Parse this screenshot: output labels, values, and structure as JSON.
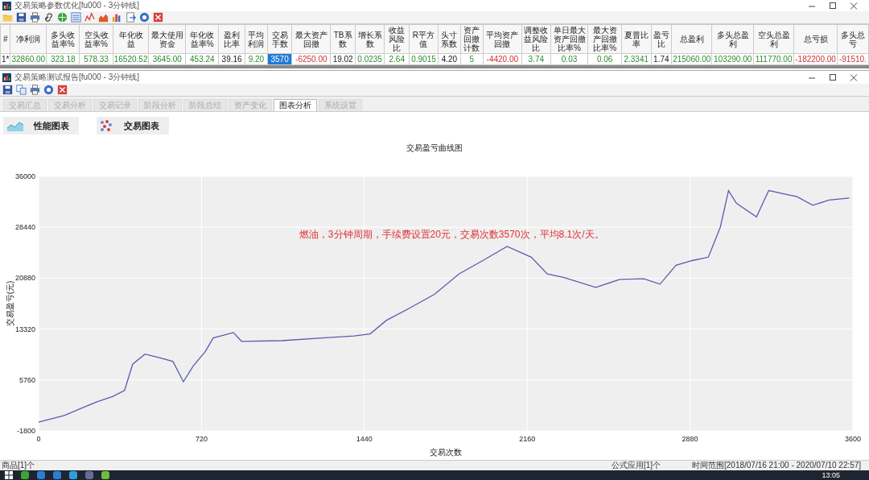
{
  "window": {
    "title": "交易策略参数优化[fu000 - 3分钟线]"
  },
  "table": {
    "columns": [
      "#",
      "净利润",
      "多头收益率%",
      "空头收益率%",
      "年化收益",
      "最大使用资金",
      "年化收益率%",
      "盈利比率",
      "平均利润",
      "交易手数",
      "最大资产回撤",
      "TB系数",
      "增长系数",
      "收益风险比",
      "R平方值",
      "头寸系数",
      "资产回撤计数",
      "平均资产回撤",
      "调整收益风险比",
      "单日最大资产回撤比率%",
      "最大资产回撤比率%",
      "夏普比率",
      "盈亏比",
      "总盈利",
      "多头总盈利",
      "空头总盈利",
      "总亏损",
      "多头总亏"
    ],
    "rows": [
      {
        "cells": [
          {
            "text": "1*",
            "kind": "plain",
            "selected": false
          },
          {
            "text": "32860.00",
            "kind": "gain",
            "selected": false
          },
          {
            "text": "323.18",
            "kind": "gain",
            "selected": false
          },
          {
            "text": "578.33",
            "kind": "gain",
            "selected": false
          },
          {
            "text": "16520.52",
            "kind": "gain",
            "selected": false
          },
          {
            "text": "3645.00",
            "kind": "gain",
            "selected": false
          },
          {
            "text": "453.24",
            "kind": "gain",
            "selected": false
          },
          {
            "text": "39.16",
            "kind": "plain",
            "selected": false
          },
          {
            "text": "9.20",
            "kind": "gain",
            "selected": false
          },
          {
            "text": "3570",
            "kind": "plain",
            "selected": true
          },
          {
            "text": "-6250.00",
            "kind": "loss",
            "selected": false
          },
          {
            "text": "19.02",
            "kind": "plain",
            "selected": false
          },
          {
            "text": "0.0235",
            "kind": "gain",
            "selected": false
          },
          {
            "text": "2.64",
            "kind": "gain",
            "selected": false
          },
          {
            "text": "0.9015",
            "kind": "gain",
            "selected": false
          },
          {
            "text": "4.20",
            "kind": "plain",
            "selected": false
          },
          {
            "text": "5",
            "kind": "gain",
            "selected": false
          },
          {
            "text": "-4420.00",
            "kind": "loss",
            "selected": false
          },
          {
            "text": "3.74",
            "kind": "gain",
            "selected": false
          },
          {
            "text": "0.03",
            "kind": "gain",
            "selected": false
          },
          {
            "text": "0.06",
            "kind": "gain",
            "selected": false
          },
          {
            "text": "2.3341",
            "kind": "gain",
            "selected": false
          },
          {
            "text": "1.74",
            "kind": "plain",
            "selected": false
          },
          {
            "text": "215060.00",
            "kind": "gain",
            "selected": false
          },
          {
            "text": "103290.00",
            "kind": "gain",
            "selected": false
          },
          {
            "text": "111770.00",
            "kind": "gain",
            "selected": false
          },
          {
            "text": "-182200.00",
            "kind": "loss",
            "selected": false
          },
          {
            "text": "-91510.",
            "kind": "loss",
            "selected": false
          }
        ]
      }
    ]
  },
  "report": {
    "title": "交易策略测试报告[fu000 - 3分钟线]",
    "tabs": [
      {
        "label": "交易汇总",
        "selected": false
      },
      {
        "label": "交易分析",
        "selected": false
      },
      {
        "label": "交易记录",
        "selected": false
      },
      {
        "label": "阶段分析",
        "selected": false
      },
      {
        "label": "阶段总结",
        "selected": false
      },
      {
        "label": "资产变化",
        "selected": false
      },
      {
        "label": "图表分析",
        "selected": true
      },
      {
        "label": "系统设置",
        "selected": false
      }
    ],
    "chart_buttons": [
      {
        "label": "性能图表",
        "kind": "area"
      },
      {
        "label": "交易图表",
        "kind": "scatter"
      }
    ],
    "chart_data": {
      "type": "line",
      "title": "交易盈亏曲线图",
      "xlabel": "交易次数",
      "ylabel": "交易盈亏(元)",
      "x": [
        0,
        114,
        185,
        256,
        327,
        380,
        416,
        470,
        541,
        594,
        640,
        683,
        737,
        772,
        861,
        897,
        1075,
        1253,
        1395,
        1466,
        1537,
        1644,
        1751,
        1858,
        1964,
        2071,
        2178,
        2249,
        2320,
        2463,
        2570,
        2676,
        2747,
        2818,
        2890,
        2961,
        3014,
        3050,
        3085,
        3174,
        3228,
        3281,
        3352,
        3423,
        3495,
        3584
      ],
      "series": [
        {
          "color": "#5b5bb0",
          "values": [
            -500,
            500,
            1500,
            2500,
            3300,
            4200,
            8100,
            9600,
            9000,
            8500,
            5500,
            7800,
            10000,
            12000,
            12800,
            11500,
            11600,
            12000,
            12300,
            12600,
            14600,
            16500,
            18500,
            21500,
            23500,
            25600,
            24000,
            21500,
            21000,
            19500,
            20700,
            20800,
            20000,
            22800,
            23500,
            24000,
            28500,
            33900,
            32000,
            30000,
            33900,
            33500,
            33000,
            31700,
            32500,
            32800
          ]
        }
      ],
      "xlim": [
        0,
        3600
      ],
      "ylim": [
        -1800,
        36000
      ],
      "xticks": [
        0,
        720,
        1440,
        2160,
        2880,
        3600
      ],
      "yticks": [
        -1800,
        5760,
        13320,
        20880,
        28440,
        36000
      ],
      "grid": true,
      "annotations": [
        "燃油，3分钟周期，手续费设置20元，交易次数3570次，平均8.1次/天。"
      ]
    },
    "status_bar": {
      "left": "商品[1]个",
      "middle": "公式应用[1]个",
      "right": "时间范围[2018/07/16 21:00 - 2020/07/10 22:57]"
    }
  },
  "taskbar": {
    "clock": "13:05"
  }
}
